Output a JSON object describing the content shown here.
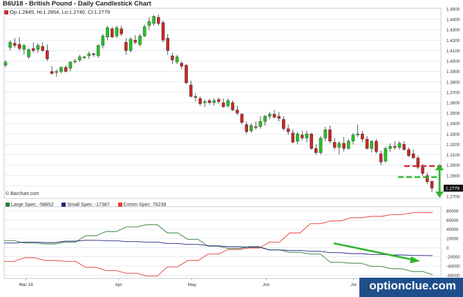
{
  "title": "B6U18 - British Pound - Daily Candlestick Chart",
  "ohlc_readout": "Op:1.2845, Hi:1.2854, Lo:1.2740, Cl:1.2779",
  "copyright": "© Barchart.com",
  "last_price_label": "1.2779",
  "watermark": "optionclue.com",
  "colors": {
    "up": "#22c322",
    "down": "#c62828",
    "large_spec": "#2e7d32",
    "small_spec": "#1a237e",
    "comm_spec": "#e53935",
    "annotation_red": "#d32f2f",
    "annotation_green": "#2db52d",
    "grid": "#d8dde4"
  },
  "legend": {
    "large": "Large Spec: -58852",
    "small": "Small Spec: -17387",
    "comm": "Comm Spec: 76239"
  },
  "chart_data": [
    {
      "type": "candlestick",
      "title": "B6U18 - British Pound - Daily Candlestick Chart",
      "y_ticks": [
        "1.4500",
        "1.4400",
        "1.4300",
        "1.4200",
        "1.4100",
        "1.4000",
        "1.3900",
        "1.3800",
        "1.3700",
        "1.3600",
        "1.3500",
        "1.3400",
        "1.3300",
        "1.3200",
        "1.3100",
        "1.3000",
        "1.2900",
        "1.2800",
        "1.2700"
      ],
      "ylim": [
        1.27,
        1.45
      ],
      "x_labels": [
        "Mar 18",
        "Apr",
        "May",
        "Jun",
        "Jul"
      ],
      "grid": true,
      "ohlc": [
        [
          1.396,
          1.401,
          1.394,
          1.399
        ],
        [
          1.413,
          1.42,
          1.41,
          1.418
        ],
        [
          1.417,
          1.422,
          1.413,
          1.415
        ],
        [
          1.416,
          1.423,
          1.41,
          1.412
        ],
        [
          1.411,
          1.416,
          1.406,
          1.415
        ],
        [
          1.404,
          1.412,
          1.402,
          1.411
        ],
        [
          1.412,
          1.418,
          1.408,
          1.41
        ],
        [
          1.411,
          1.417,
          1.408,
          1.415
        ],
        [
          1.414,
          1.418,
          1.409,
          1.41
        ],
        [
          1.41,
          1.416,
          1.4,
          1.402
        ],
        [
          1.39,
          1.395,
          1.387,
          1.388
        ],
        [
          1.389,
          1.392,
          1.385,
          1.39
        ],
        [
          1.39,
          1.395,
          1.388,
          1.394
        ],
        [
          1.394,
          1.396,
          1.389,
          1.39
        ],
        [
          1.393,
          1.4,
          1.39,
          1.399
        ],
        [
          1.399,
          1.402,
          1.398,
          1.4
        ],
        [
          1.401,
          1.406,
          1.399,
          1.404
        ],
        [
          1.403,
          1.405,
          1.402,
          1.404
        ],
        [
          1.405,
          1.409,
          1.402,
          1.407
        ],
        [
          1.407,
          1.408,
          1.404,
          1.406
        ],
        [
          1.405,
          1.416,
          1.403,
          1.415
        ],
        [
          1.415,
          1.426,
          1.412,
          1.424
        ],
        [
          1.423,
          1.434,
          1.42,
          1.432
        ],
        [
          1.431,
          1.433,
          1.422,
          1.423
        ],
        [
          1.424,
          1.434,
          1.422,
          1.432
        ],
        [
          1.431,
          1.434,
          1.424,
          1.426
        ],
        [
          1.418,
          1.422,
          1.406,
          1.41
        ],
        [
          1.41,
          1.423,
          1.408,
          1.421
        ],
        [
          1.42,
          1.425,
          1.416,
          1.418
        ],
        [
          1.416,
          1.426,
          1.414,
          1.424
        ],
        [
          1.424,
          1.435,
          1.423,
          1.433
        ],
        [
          1.434,
          1.442,
          1.43,
          1.438
        ],
        [
          1.436,
          1.444,
          1.434,
          1.443
        ],
        [
          1.442,
          1.445,
          1.434,
          1.436
        ],
        [
          1.437,
          1.439,
          1.418,
          1.42
        ],
        [
          1.422,
          1.426,
          1.406,
          1.41
        ],
        [
          1.405,
          1.408,
          1.397,
          1.401
        ],
        [
          1.399,
          1.406,
          1.397,
          1.404
        ],
        [
          1.398,
          1.4,
          1.392,
          1.395
        ],
        [
          1.396,
          1.397,
          1.378,
          1.379
        ],
        [
          1.377,
          1.381,
          1.365,
          1.366
        ],
        [
          1.366,
          1.369,
          1.361,
          1.365
        ],
        [
          1.364,
          1.366,
          1.357,
          1.359
        ],
        [
          1.36,
          1.363,
          1.356,
          1.361
        ],
        [
          1.362,
          1.364,
          1.358,
          1.36
        ],
        [
          1.36,
          1.364,
          1.357,
          1.362
        ],
        [
          1.363,
          1.365,
          1.359,
          1.361
        ],
        [
          1.36,
          1.364,
          1.355,
          1.356
        ],
        [
          1.357,
          1.364,
          1.355,
          1.362
        ],
        [
          1.36,
          1.362,
          1.352,
          1.353
        ],
        [
          1.353,
          1.357,
          1.348,
          1.35
        ],
        [
          1.349,
          1.35,
          1.339,
          1.341
        ],
        [
          1.339,
          1.342,
          1.33,
          1.332
        ],
        [
          1.333,
          1.34,
          1.331,
          1.338
        ],
        [
          1.337,
          1.342,
          1.334,
          1.336
        ],
        [
          1.337,
          1.347,
          1.335,
          1.342
        ],
        [
          1.342,
          1.348,
          1.338,
          1.347
        ],
        [
          1.347,
          1.351,
          1.344,
          1.349
        ],
        [
          1.349,
          1.353,
          1.345,
          1.346
        ],
        [
          1.347,
          1.351,
          1.342,
          1.345
        ],
        [
          1.344,
          1.347,
          1.333,
          1.335
        ],
        [
          1.335,
          1.339,
          1.329,
          1.332
        ],
        [
          1.331,
          1.334,
          1.321,
          1.322
        ],
        [
          1.323,
          1.332,
          1.32,
          1.33
        ],
        [
          1.329,
          1.333,
          1.324,
          1.326
        ],
        [
          1.326,
          1.333,
          1.322,
          1.33
        ],
        [
          1.33,
          1.331,
          1.315,
          1.316
        ],
        [
          1.316,
          1.32,
          1.31,
          1.312
        ],
        [
          1.312,
          1.328,
          1.31,
          1.326
        ],
        [
          1.326,
          1.337,
          1.323,
          1.334
        ],
        [
          1.334,
          1.338,
          1.321,
          1.323
        ],
        [
          1.322,
          1.326,
          1.315,
          1.317
        ],
        [
          1.317,
          1.323,
          1.31,
          1.321
        ],
        [
          1.321,
          1.327,
          1.313,
          1.316
        ],
        [
          1.316,
          1.325,
          1.315,
          1.323
        ],
        [
          1.323,
          1.331,
          1.32,
          1.329
        ],
        [
          1.329,
          1.339,
          1.327,
          1.33
        ],
        [
          1.33,
          1.333,
          1.322,
          1.325
        ],
        [
          1.325,
          1.328,
          1.315,
          1.316
        ],
        [
          1.316,
          1.324,
          1.312,
          1.323
        ],
        [
          1.323,
          1.325,
          1.311,
          1.313
        ],
        [
          1.311,
          1.314,
          1.3,
          1.303
        ],
        [
          1.304,
          1.318,
          1.302,
          1.316
        ],
        [
          1.316,
          1.321,
          1.313,
          1.318
        ],
        [
          1.318,
          1.323,
          1.315,
          1.317
        ],
        [
          1.317,
          1.323,
          1.315,
          1.321
        ],
        [
          1.32,
          1.323,
          1.314,
          1.315
        ],
        [
          1.315,
          1.317,
          1.308,
          1.309
        ],
        [
          1.311,
          1.315,
          1.306,
          1.307
        ],
        [
          1.307,
          1.309,
          1.296,
          1.298
        ],
        [
          1.298,
          1.301,
          1.29,
          1.292
        ],
        [
          1.29,
          1.293,
          1.282,
          1.284
        ],
        [
          1.2845,
          1.2854,
          1.274,
          1.2779
        ]
      ]
    },
    {
      "type": "line",
      "title": "",
      "y_ticks": [
        "80000",
        "60000",
        "40000",
        "20000",
        "0",
        "-20000",
        "-40000",
        "-60000"
      ],
      "ylim": [
        -64000,
        86000
      ],
      "x_labels": [
        "Mar 18",
        "Apr",
        "May",
        "Jun",
        "Jul"
      ],
      "series": [
        {
          "name": "Large Spec",
          "values": [
            15000,
            15000,
            10000,
            10000,
            8000,
            8000,
            12000,
            12000,
            26000,
            26000,
            35000,
            35000,
            45000,
            45000,
            50000,
            50000,
            32000,
            32000,
            18000,
            18000,
            3000,
            3000,
            -2000,
            -2000,
            2000,
            2000,
            -5000,
            -5000,
            -10000,
            -10000,
            -14000,
            -14000,
            -32000,
            -32000,
            -34000,
            -34000,
            -41000,
            -41000,
            -46000,
            -46000,
            -52000,
            -52000,
            -58852
          ]
        },
        {
          "name": "Small Spec",
          "values": [
            10000,
            10000,
            12000,
            12000,
            11000,
            11000,
            14000,
            14000,
            16000,
            16000,
            15000,
            15000,
            13000,
            13000,
            12000,
            12000,
            9000,
            9000,
            7000,
            7000,
            4000,
            4000,
            2000,
            2000,
            1000,
            1000,
            -5000,
            -5000,
            -6000,
            -6000,
            -8000,
            -8000,
            -11000,
            -11000,
            -13000,
            -13000,
            -15000,
            -15000,
            -16000,
            -16000,
            -17000,
            -17000,
            -17387
          ]
        },
        {
          "name": "Comm Spec",
          "values": [
            -30000,
            -30000,
            -22000,
            -22000,
            -28000,
            -28000,
            -30000,
            -30000,
            -43000,
            -43000,
            -50000,
            -50000,
            -56000,
            -56000,
            -62000,
            -62000,
            -42000,
            -42000,
            -28000,
            -28000,
            -14000,
            -14000,
            -4000,
            -4000,
            -1000,
            -1000,
            12000,
            12000,
            32000,
            32000,
            52000,
            52000,
            58000,
            58000,
            65000,
            65000,
            68000,
            68000,
            72000,
            72000,
            76000,
            76000,
            76239
          ]
        }
      ]
    }
  ]
}
